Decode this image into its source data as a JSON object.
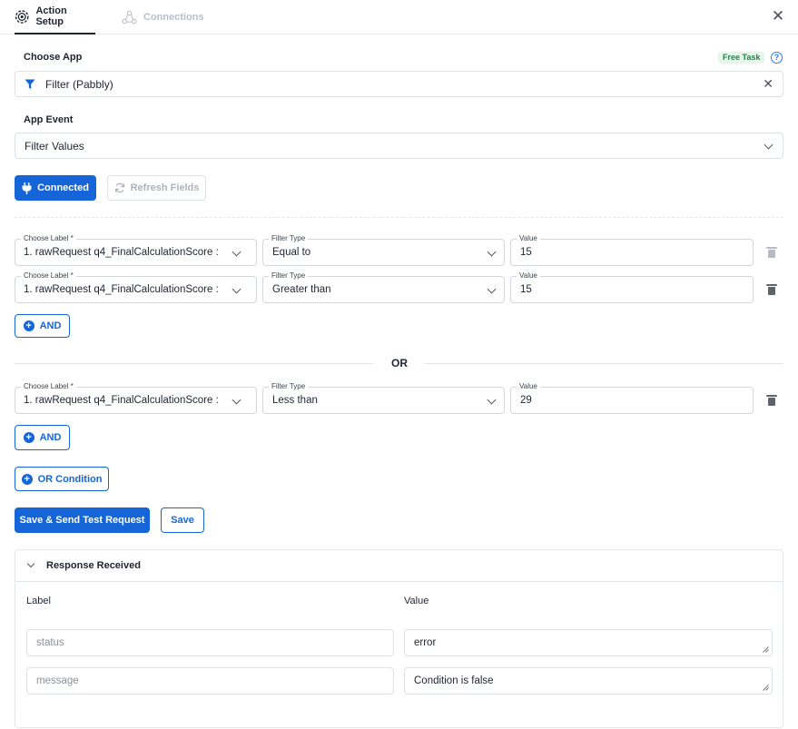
{
  "tabs": {
    "action_setup": "Action Setup",
    "connections": "Connections"
  },
  "choose_app": {
    "label": "Choose App",
    "badge": "Free Task",
    "help": "?",
    "value": "Filter (Pabbly)"
  },
  "app_event": {
    "label": "App Event",
    "value": "Filter Values"
  },
  "buttons": {
    "connected": "Connected",
    "refresh_fields": "Refresh Fields",
    "and": "AND",
    "or_condition": "OR Condition",
    "save_send": "Save & Send Test Request",
    "save": "Save"
  },
  "or_divider": "OR",
  "condition_groups": [
    {
      "rows": [
        {
          "label_caption": "Choose Label *",
          "label_value": "1. rawRequest q4_FinalCalculationScore :",
          "type_caption": "Filter Type",
          "type_value": "Equal to",
          "value_caption": "Value",
          "value": "15"
        },
        {
          "label_caption": "Choose Label *",
          "label_value": "1. rawRequest q4_FinalCalculationScore :",
          "type_caption": "Filter Type",
          "type_value": "Greater than",
          "value_caption": "Value",
          "value": "15"
        }
      ]
    },
    {
      "rows": [
        {
          "label_caption": "Choose Label *",
          "label_value": "1. rawRequest q4_FinalCalculationScore :",
          "type_caption": "Filter Type",
          "type_value": "Less than",
          "value_caption": "Value",
          "value": "29"
        }
      ]
    }
  ],
  "response": {
    "title": "Response Received",
    "col_label": "Label",
    "col_value": "Value",
    "rows": [
      {
        "label": "status",
        "value": "error"
      },
      {
        "label": "message",
        "value": "Condition is false"
      }
    ]
  },
  "colors": {
    "primary": "#1565d8",
    "badge_bg": "#e5f6ea",
    "badge_text": "#1c8a42",
    "trash_disabled": "#b6bbc3",
    "trash_active": "#5f646c"
  }
}
